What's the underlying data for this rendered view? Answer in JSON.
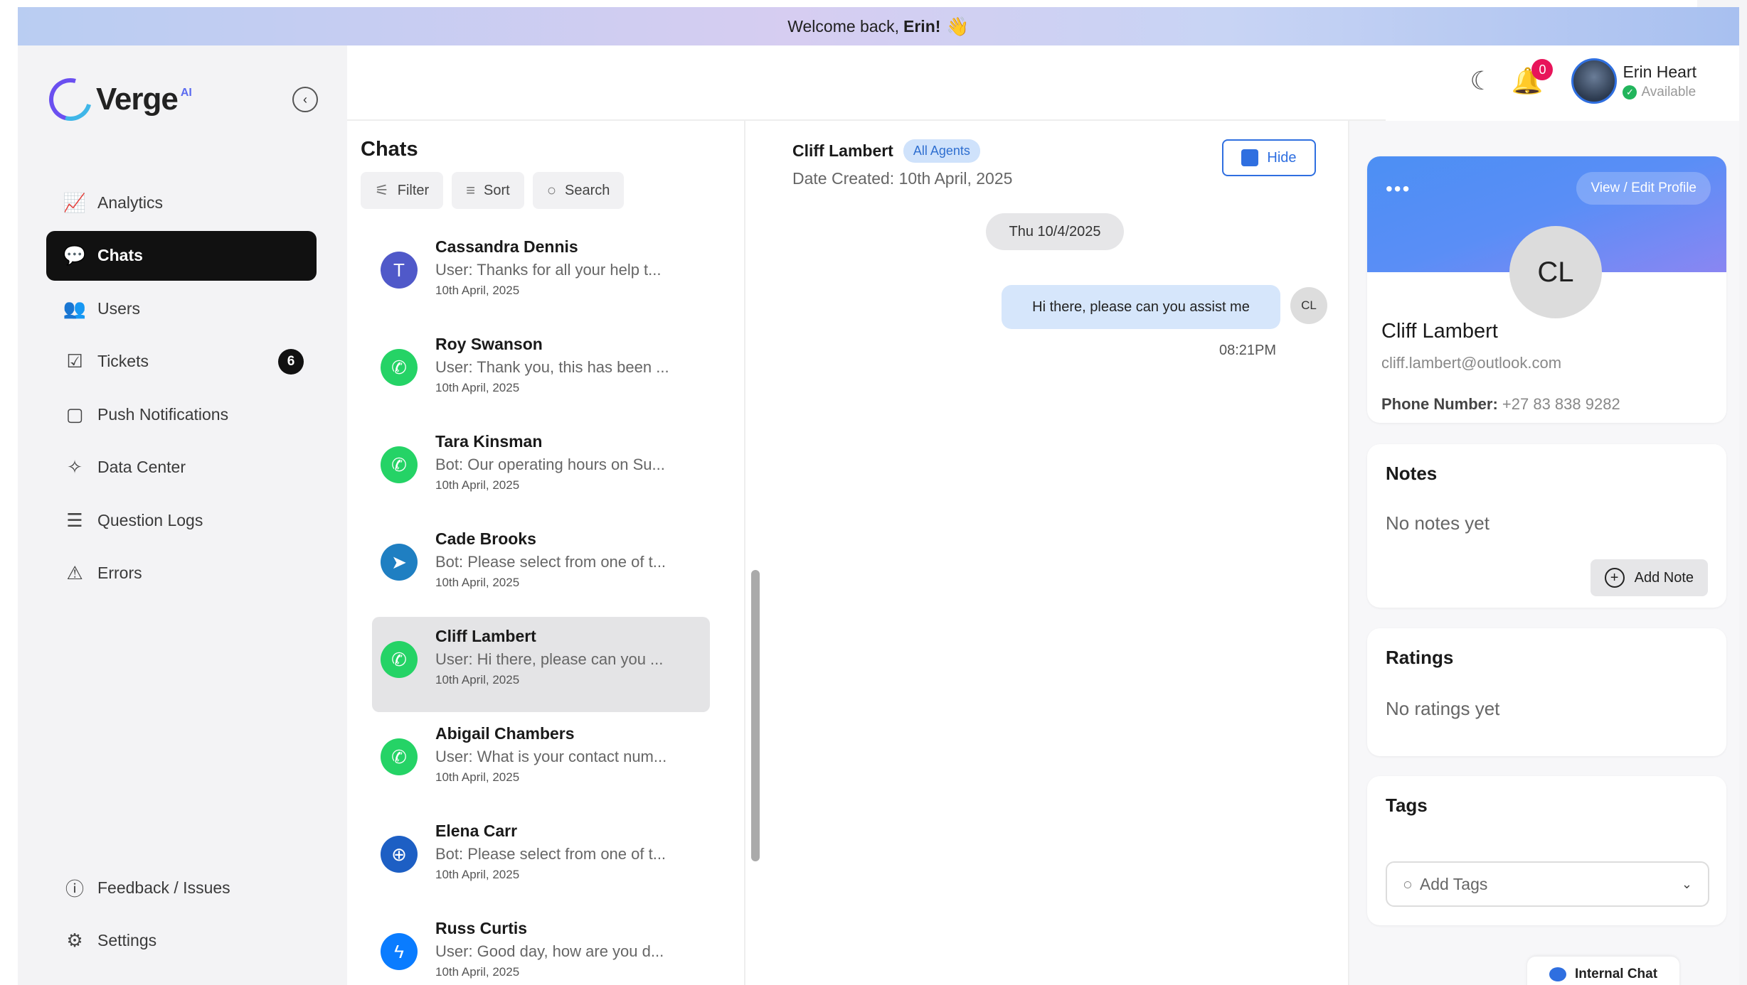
{
  "banner": {
    "prefix": "Welcome back,",
    "name": "Erin!",
    "emoji": "👋"
  },
  "logo": {
    "text": "Verge",
    "badge": "AI"
  },
  "sidebar": {
    "collapse_icon": "chevron-left-icon",
    "items": [
      {
        "label": "Analytics",
        "icon": "chart-line-icon"
      },
      {
        "label": "Chats",
        "icon": "chat-bubble-icon",
        "active": true
      },
      {
        "label": "Users",
        "icon": "users-icon"
      },
      {
        "label": "Tickets",
        "icon": "ticket-icon",
        "badge": "6"
      },
      {
        "label": "Push Notifications",
        "icon": "notification-icon"
      },
      {
        "label": "Data Center",
        "icon": "data-center-icon"
      },
      {
        "label": "Question Logs",
        "icon": "list-icon"
      },
      {
        "label": "Errors",
        "icon": "warning-icon"
      }
    ],
    "bottom_items": [
      {
        "label": "Feedback / Issues",
        "icon": "info-icon"
      },
      {
        "label": "Settings",
        "icon": "gear-icon"
      }
    ]
  },
  "header": {
    "theme_icon": "moon-icon",
    "notification_count": "0",
    "user_name": "Erin Heart",
    "user_status": "Available"
  },
  "chat_list": {
    "title": "Chats",
    "filter_label": "Filter",
    "sort_label": "Sort",
    "search_label": "Search",
    "items": [
      {
        "name": "Cassandra Dennis",
        "preview": "User: Thanks for all your help t...",
        "date": "10th April, 2025",
        "channel": "teams",
        "color": "#5059c9"
      },
      {
        "name": "Roy Swanson",
        "preview": "User: Thank you, this has been ...",
        "date": "10th April, 2025",
        "channel": "whatsapp",
        "color": "#25d366"
      },
      {
        "name": "Tara Kinsman",
        "preview": "Bot: Our operating hours on Su...",
        "date": "10th April, 2025",
        "channel": "whatsapp",
        "color": "#25d366"
      },
      {
        "name": "Cade Brooks",
        "preview": "Bot: Please select from one of t...",
        "date": "10th April, 2025",
        "channel": "telegram",
        "color": "#1f7fc2"
      },
      {
        "name": "Cliff Lambert",
        "preview": "User: Hi there, please can you ...",
        "date": "10th April, 2025",
        "channel": "whatsapp",
        "color": "#25d366",
        "selected": true
      },
      {
        "name": "Abigail Chambers",
        "preview": "User: What is your contact num...",
        "date": "10th April, 2025",
        "channel": "whatsapp",
        "color": "#25d366"
      },
      {
        "name": "Elena Carr",
        "preview": "Bot: Please select from one of t...",
        "date": "10th April, 2025",
        "channel": "web",
        "color": "#1d5fc4"
      },
      {
        "name": "Russ Curtis",
        "preview": "User: Good day, how are you d...",
        "date": "10th April, 2025",
        "channel": "messenger",
        "color": "#0a7cff"
      }
    ]
  },
  "conversation": {
    "name": "Cliff Lambert",
    "agents_label": "All Agents",
    "date_created": "Date Created: 10th April, 2025",
    "hide_label": "Hide",
    "day_label": "Thu 10/4/2025",
    "message": "Hi there, please can you assist me",
    "message_avatar": "CL",
    "message_time": "08:21PM"
  },
  "profile": {
    "menu_dots": "•••",
    "view_edit_label": "View / Edit Profile",
    "initials": "CL",
    "name": "Cliff Lambert",
    "email": "cliff.lambert@outlook.com",
    "phone_label": "Phone Number:",
    "phone_value": "+27 83 838 9282"
  },
  "notes": {
    "title": "Notes",
    "empty": "No notes yet",
    "add_label": "Add Note"
  },
  "ratings": {
    "title": "Ratings",
    "empty": "No ratings yet"
  },
  "tags": {
    "title": "Tags",
    "placeholder": "Add Tags"
  },
  "internal_chat": {
    "label": "Internal Chat"
  }
}
